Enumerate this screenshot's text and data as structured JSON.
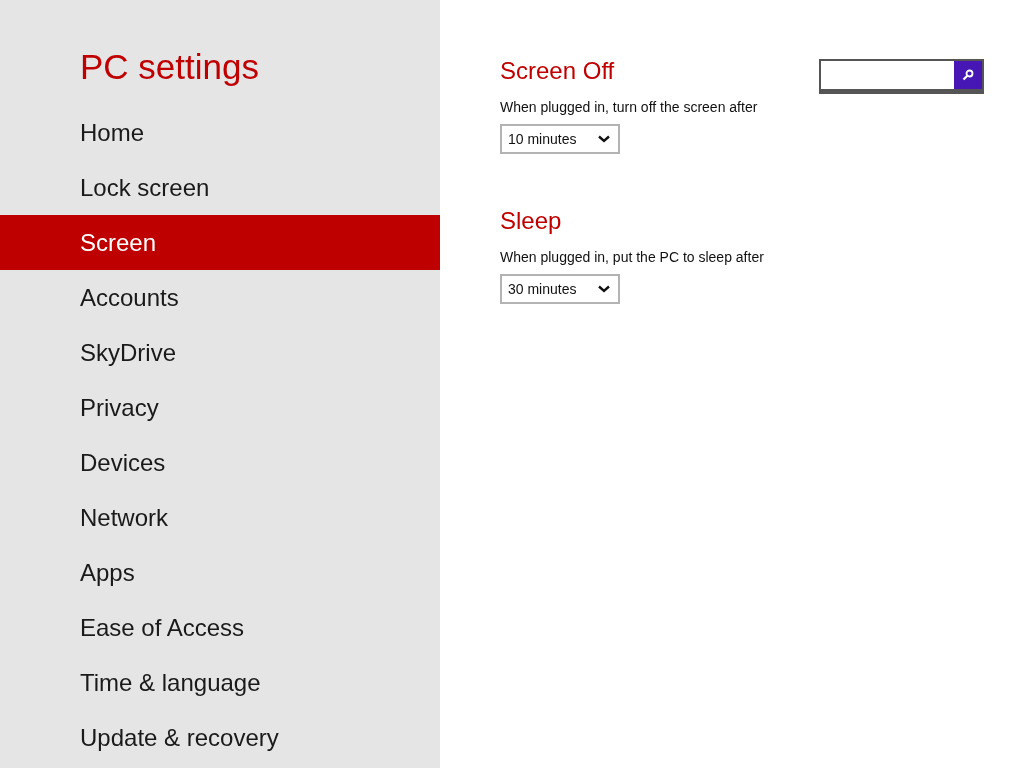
{
  "sidebar": {
    "title": "PC settings",
    "items": [
      {
        "label": "Home",
        "selected": false
      },
      {
        "label": "Lock screen",
        "selected": false
      },
      {
        "label": "Screen",
        "selected": true
      },
      {
        "label": "Accounts",
        "selected": false
      },
      {
        "label": "SkyDrive",
        "selected": false
      },
      {
        "label": "Privacy",
        "selected": false
      },
      {
        "label": "Devices",
        "selected": false
      },
      {
        "label": "Network",
        "selected": false
      },
      {
        "label": "Apps",
        "selected": false
      },
      {
        "label": "Ease of Access",
        "selected": false
      },
      {
        "label": "Time & language",
        "selected": false
      },
      {
        "label": "Update & recovery",
        "selected": false
      }
    ]
  },
  "sections": [
    {
      "heading": "Screen Off",
      "label": "When plugged in, turn off the screen after",
      "value": "10 minutes"
    },
    {
      "heading": "Sleep",
      "label": "When plugged in, put the PC to sleep after",
      "value": "30 minutes"
    }
  ]
}
